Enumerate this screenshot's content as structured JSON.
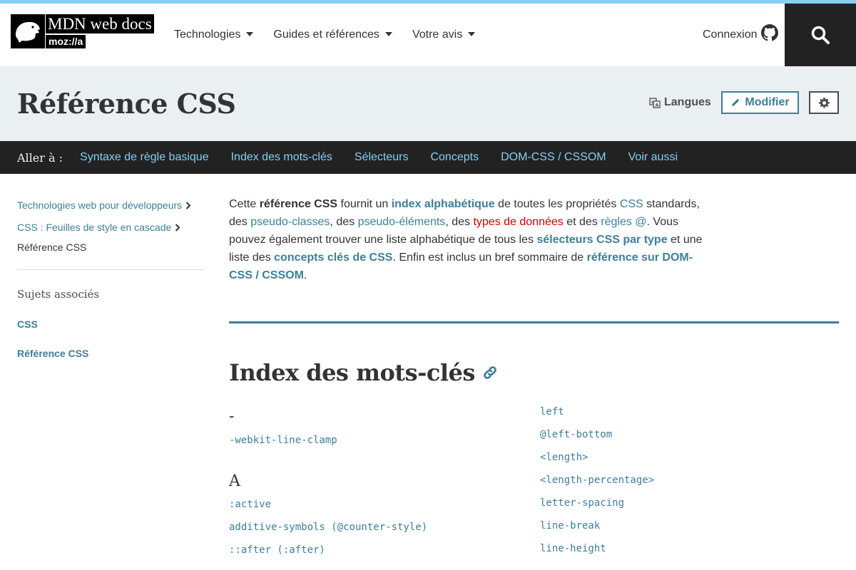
{
  "header": {
    "logo_text": "MDN web docs",
    "logo_sub": "moz://a",
    "nav": [
      "Technologies",
      "Guides et références",
      "Votre avis"
    ],
    "login": "Connexion"
  },
  "titlebar": {
    "title": "Référence CSS",
    "languages": "Langues",
    "edit": "Modifier"
  },
  "jump": {
    "label": "Aller à :",
    "links": [
      "Syntaxe de règle basique",
      "Index des mots-clés",
      "Sélecteurs",
      "Concepts",
      "DOM-CSS / CSSOM",
      "Voir aussi"
    ]
  },
  "sidebar": {
    "breadcrumbs": [
      "Technologies web pour développeurs",
      "CSS : Feuilles de style en cascade"
    ],
    "current": "Référence CSS",
    "related_title": "Sujets associés",
    "links": [
      "CSS",
      "Référence CSS"
    ]
  },
  "intro": {
    "p1_a": "Cette ",
    "p1_b": "référence CSS",
    "p1_c": " fournit un ",
    "p1_d": "index alphabétique",
    "p1_e": " de toutes les propriétés ",
    "p1_f": "CSS",
    "p1_g": " standards, des ",
    "p1_h": "pseudo-classes",
    "p1_i": ", des ",
    "p1_j": "pseudo-éléments",
    "p1_k": ", des ",
    "p1_l": "types de données",
    "p1_m": " et des ",
    "p1_n": "règles @",
    "p1_o": ". Vous pouvez également trouver une liste alphabétique de tous les ",
    "p1_p": "sélecteurs CSS par type",
    "p1_q": " et une liste des ",
    "p1_r": "concepts clés de CSS",
    "p1_s": ". Enfin est inclus un bref sommaire de ",
    "p1_t": "référence sur DOM-CSS / CSSOM",
    "p1_u": "."
  },
  "keywords": {
    "title": "Index des mots-clés",
    "col1_dash_letter": "-",
    "col1_dash_items": [
      "-webkit-line-clamp"
    ],
    "col1_a_letter": "A",
    "col1_a_items": [
      ":active",
      "additive-symbols (@counter-style)",
      "::after (:after)"
    ],
    "col2_items": [
      "left",
      "@left-bottom",
      "<length>",
      "<length-percentage>",
      "letter-spacing",
      "line-break",
      "line-height"
    ]
  },
  "colors": {
    "accent": "#3d7e9a",
    "topline": "#83d0f2",
    "jumpbar": "#222222",
    "titlebar": "#eaeff2",
    "visited_red": "#cc0000"
  }
}
